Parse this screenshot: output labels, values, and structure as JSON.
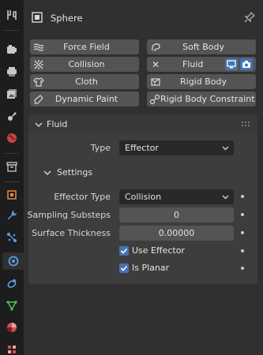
{
  "header": {
    "object_name": "Sphere",
    "object_icon": "object-icon",
    "pin_icon": "pin-icon"
  },
  "tabs": [
    {
      "name": "tool-tab",
      "icon": "tool-icon"
    },
    {
      "name": "render-tab",
      "icon": "render-icon"
    },
    {
      "name": "output-tab",
      "icon": "output-icon"
    },
    {
      "name": "view-layer-tab",
      "icon": "view-layer-icon"
    },
    {
      "name": "scene-tab",
      "icon": "scene-icon"
    },
    {
      "name": "world-tab",
      "icon": "world-icon"
    },
    {
      "name": "collection-tab",
      "icon": "collection-icon"
    },
    {
      "name": "object-tab",
      "icon": "object-icon"
    },
    {
      "name": "modifiers-tab",
      "icon": "wrench-icon"
    },
    {
      "name": "particles-tab",
      "icon": "particles-icon"
    },
    {
      "name": "physics-tab",
      "icon": "physics-icon",
      "active": true
    },
    {
      "name": "constraints-tab",
      "icon": "constraints-icon"
    },
    {
      "name": "data-tab",
      "icon": "mesh-data-icon"
    },
    {
      "name": "material-tab",
      "icon": "material-icon"
    },
    {
      "name": "texture-tab",
      "icon": "texture-icon"
    }
  ],
  "physics_buttons": {
    "force_field": "Force Field",
    "soft_body": "Soft Body",
    "collision": "Collision",
    "fluid": "Fluid",
    "cloth": "Cloth",
    "rigid_body": "Rigid Body",
    "dynamic_paint": "Dynamic Paint",
    "rigid_body_constraint": "Rigid Body Constraint"
  },
  "fluid_panel": {
    "title": "Fluid",
    "type_label": "Type",
    "type_value": "Effector",
    "settings_title": "Settings",
    "effector_type_label": "Effector Type",
    "effector_type_value": "Collision",
    "sampling_substeps_label": "Sampling Substeps",
    "sampling_substeps_value": "0",
    "surface_thickness_label": "Surface Thickness",
    "surface_thickness_value": "0.00000",
    "use_effector_label": "Use Effector",
    "use_effector_checked": true,
    "is_planar_label": "Is Planar",
    "is_planar_checked": true
  },
  "colors": {
    "accent": "#4772b3",
    "panel_bg": "#3d3d3d",
    "button_bg": "#545454",
    "field_bg": "#282828",
    "tab_strip_bg": "#1d1d1d"
  }
}
